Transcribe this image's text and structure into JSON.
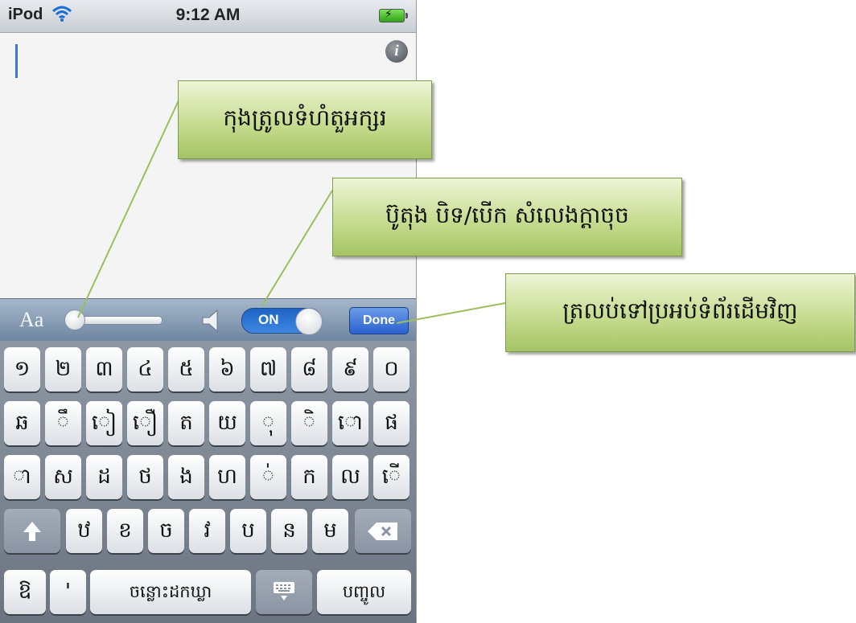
{
  "status_bar": {
    "carrier": "iPod",
    "time": "9:12 AM"
  },
  "editor": {
    "info_button": "i"
  },
  "toolbar": {
    "font_size_label": "Aa",
    "sound_toggle": "ON",
    "done_label": "Done"
  },
  "keyboard": {
    "row1": [
      "១",
      "២",
      "៣",
      "៤",
      "៥",
      "៦",
      "៧",
      "៨",
      "៩",
      "០"
    ],
    "row2": [
      "ឆ",
      "ឹ",
      "ៀ",
      "ឿ",
      "ត",
      "យ",
      "ុ",
      "ិ",
      "ោ",
      "ផ"
    ],
    "row3": [
      "ា",
      "ស",
      "ដ",
      "ថ",
      "ង",
      "ហ",
      "់",
      "ក",
      "ល",
      "ើ"
    ],
    "row4": [
      "ឋ",
      "ខ",
      "ច",
      "វ",
      "ប",
      "ន",
      "ម"
    ],
    "row5": {
      "mode": "ឱ",
      "extra": "'",
      "space": "ចន្លោះដកឃ្លា",
      "enter": "បញ្ចូល"
    }
  },
  "callouts": {
    "font_size": "កុងត្រូលទំហំតួអក្សរ",
    "sound": "ប៊ូតុង បិទ/បើក សំលេងក្ដាចុច",
    "done": "ត្រលប់ទៅប្រអប់ទំព័រដើមវិញ"
  },
  "colors": {
    "toggle_on": "#2f74d6",
    "callout_fill": "#c7dc91",
    "leader_line": "#9bbf5a"
  }
}
